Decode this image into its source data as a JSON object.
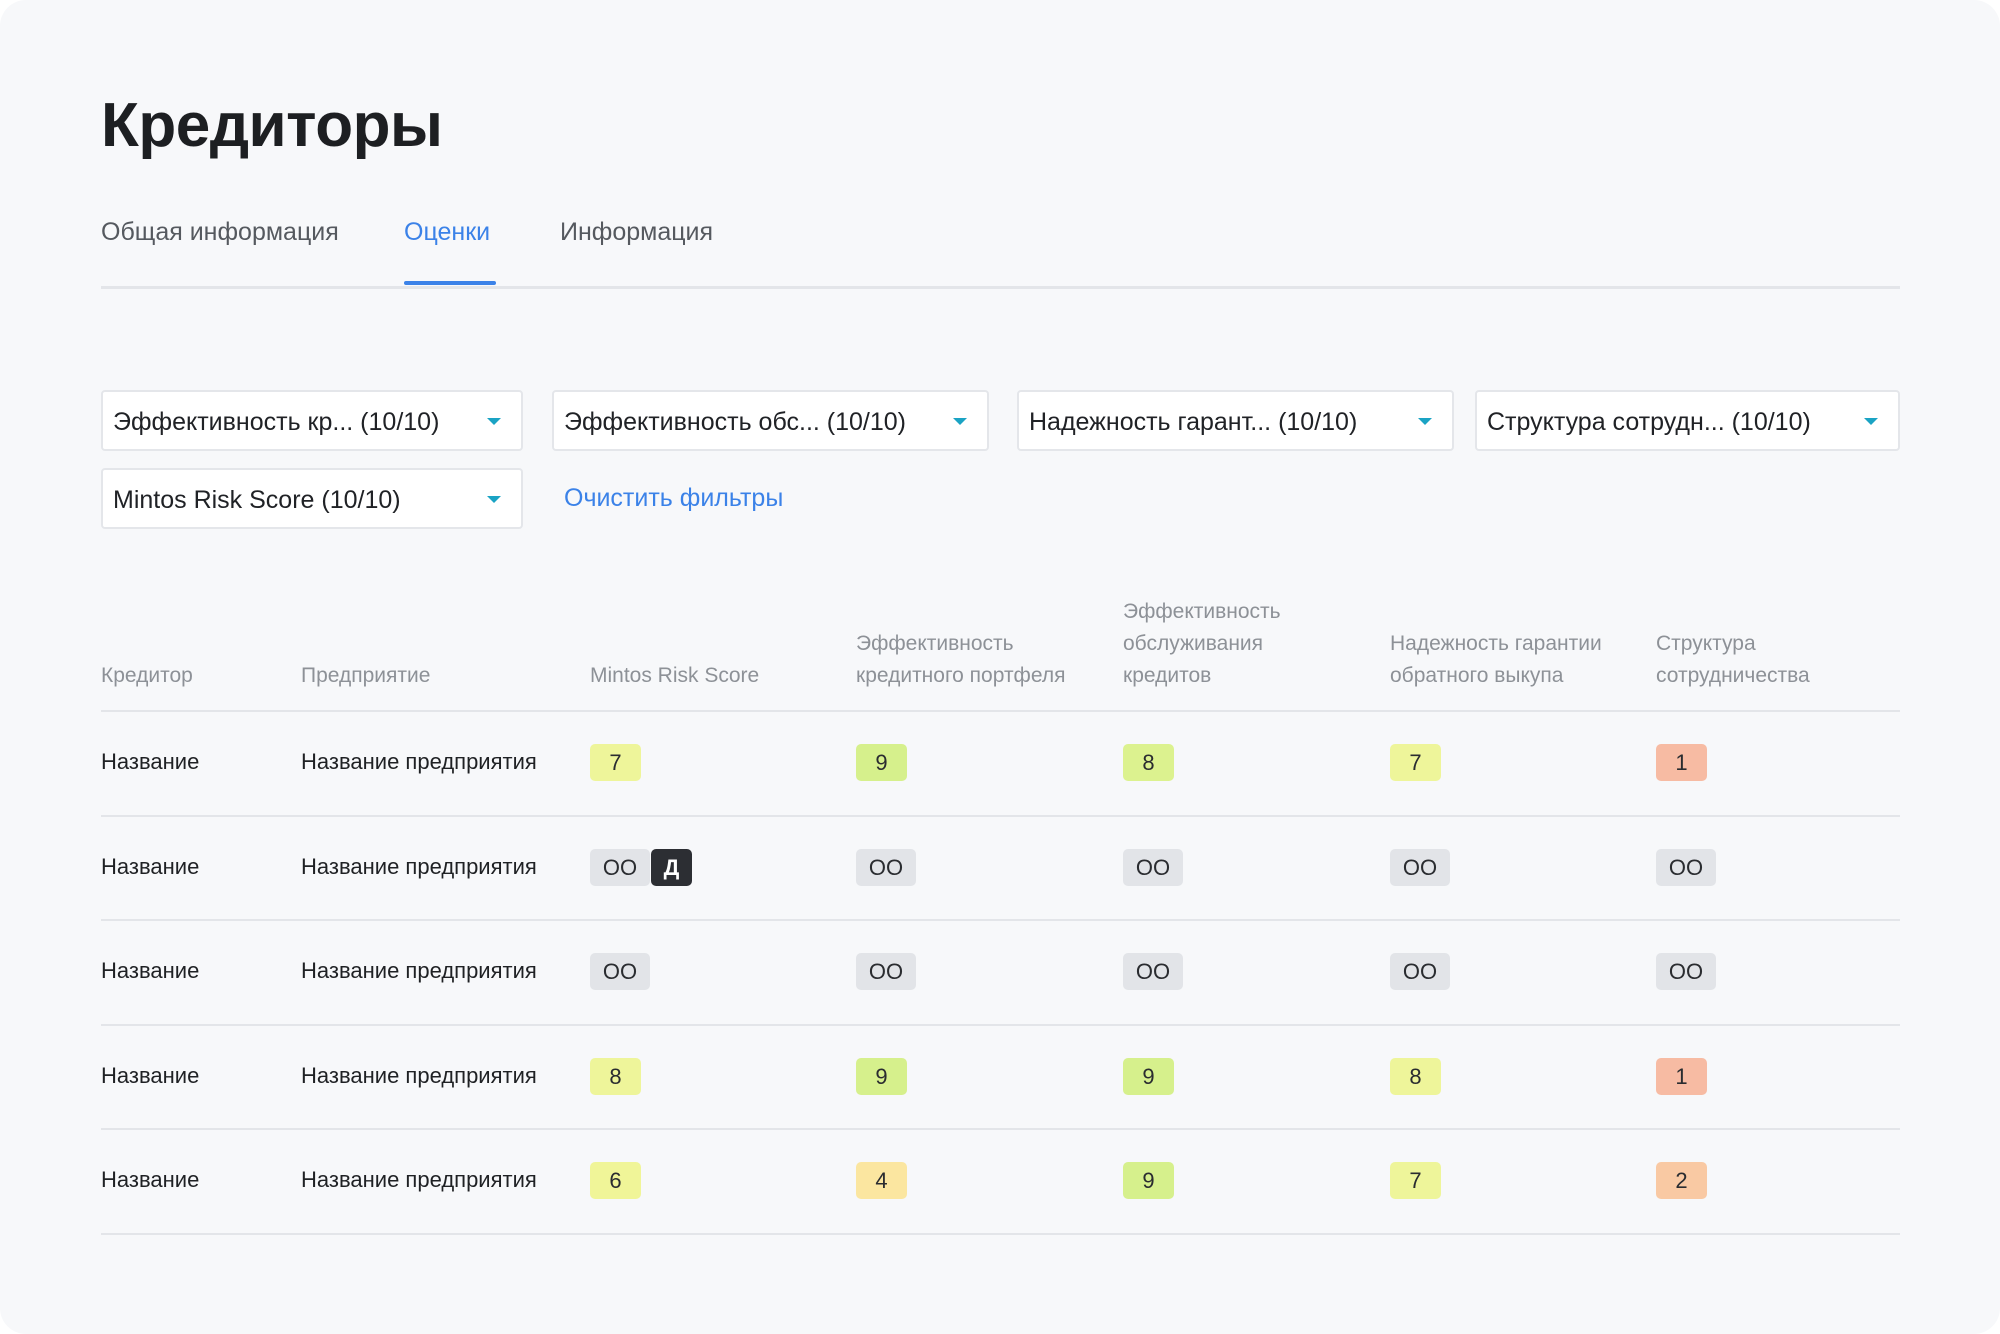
{
  "page": {
    "title": "Кредиторы"
  },
  "tabs": [
    {
      "label": "Общая информация",
      "active": false
    },
    {
      "label": "Оценки",
      "active": true
    },
    {
      "label": "Информация",
      "active": false
    }
  ],
  "filters": [
    {
      "label": "Эффективность кр... (10/10)"
    },
    {
      "label": "Эффективность обс... (10/10)"
    },
    {
      "label": "Надежность гарант... (10/10)"
    },
    {
      "label": "Структура сотрудн... (10/10)"
    },
    {
      "label": "Mintos Risk Score (10/10)"
    }
  ],
  "clear_filters_label": "Очистить фильтры",
  "table": {
    "headers": [
      [
        "Кредитор"
      ],
      [
        "Предприятие"
      ],
      [
        "Mintos Risk Score"
      ],
      [
        "Эффективность",
        "кредитного портфеля"
      ],
      [
        "Эффективность",
        "обслуживания",
        "кредитов"
      ],
      [
        "Надежность гарантии",
        "обратного выкупа"
      ],
      [
        "Структура",
        "сотрудничества"
      ]
    ],
    "rows": [
      {
        "creditor": "Название",
        "company": "Название предприятия",
        "scores": [
          {
            "value": "7",
            "color": "#eef59a"
          },
          {
            "value": "9",
            "color": "#d6f08c"
          },
          {
            "value": "8",
            "color": "#dcf28f"
          },
          {
            "value": "7",
            "color": "#eef59a"
          },
          {
            "value": "1",
            "color": "#f7bba3"
          }
        ]
      },
      {
        "creditor": "Название",
        "company": "Название предприятия",
        "scores": [
          {
            "value": "OO",
            "extra": "Д"
          },
          {
            "value": "OO"
          },
          {
            "value": "OO"
          },
          {
            "value": "OO"
          },
          {
            "value": "OO"
          }
        ]
      },
      {
        "creditor": "Название",
        "company": "Название предприятия",
        "scores": [
          {
            "value": "OO"
          },
          {
            "value": "OO"
          },
          {
            "value": "OO"
          },
          {
            "value": "OO"
          },
          {
            "value": "OO"
          }
        ]
      },
      {
        "creditor": "Название",
        "company": "Название предприятия",
        "scores": [
          {
            "value": "8",
            "color": "#eef59a"
          },
          {
            "value": "9",
            "color": "#d6f08c"
          },
          {
            "value": "9",
            "color": "#d6f08c"
          },
          {
            "value": "8",
            "color": "#eef59a"
          },
          {
            "value": "1",
            "color": "#f7bba3"
          }
        ]
      },
      {
        "creditor": "Название",
        "company": "Название предприятия",
        "scores": [
          {
            "value": "6",
            "color": "#f0f598"
          },
          {
            "value": "4",
            "color": "#fbe6a0"
          },
          {
            "value": "9",
            "color": "#d6f08c"
          },
          {
            "value": "7",
            "color": "#eef59a"
          },
          {
            "value": "2",
            "color": "#f9c9a3"
          }
        ]
      }
    ]
  }
}
